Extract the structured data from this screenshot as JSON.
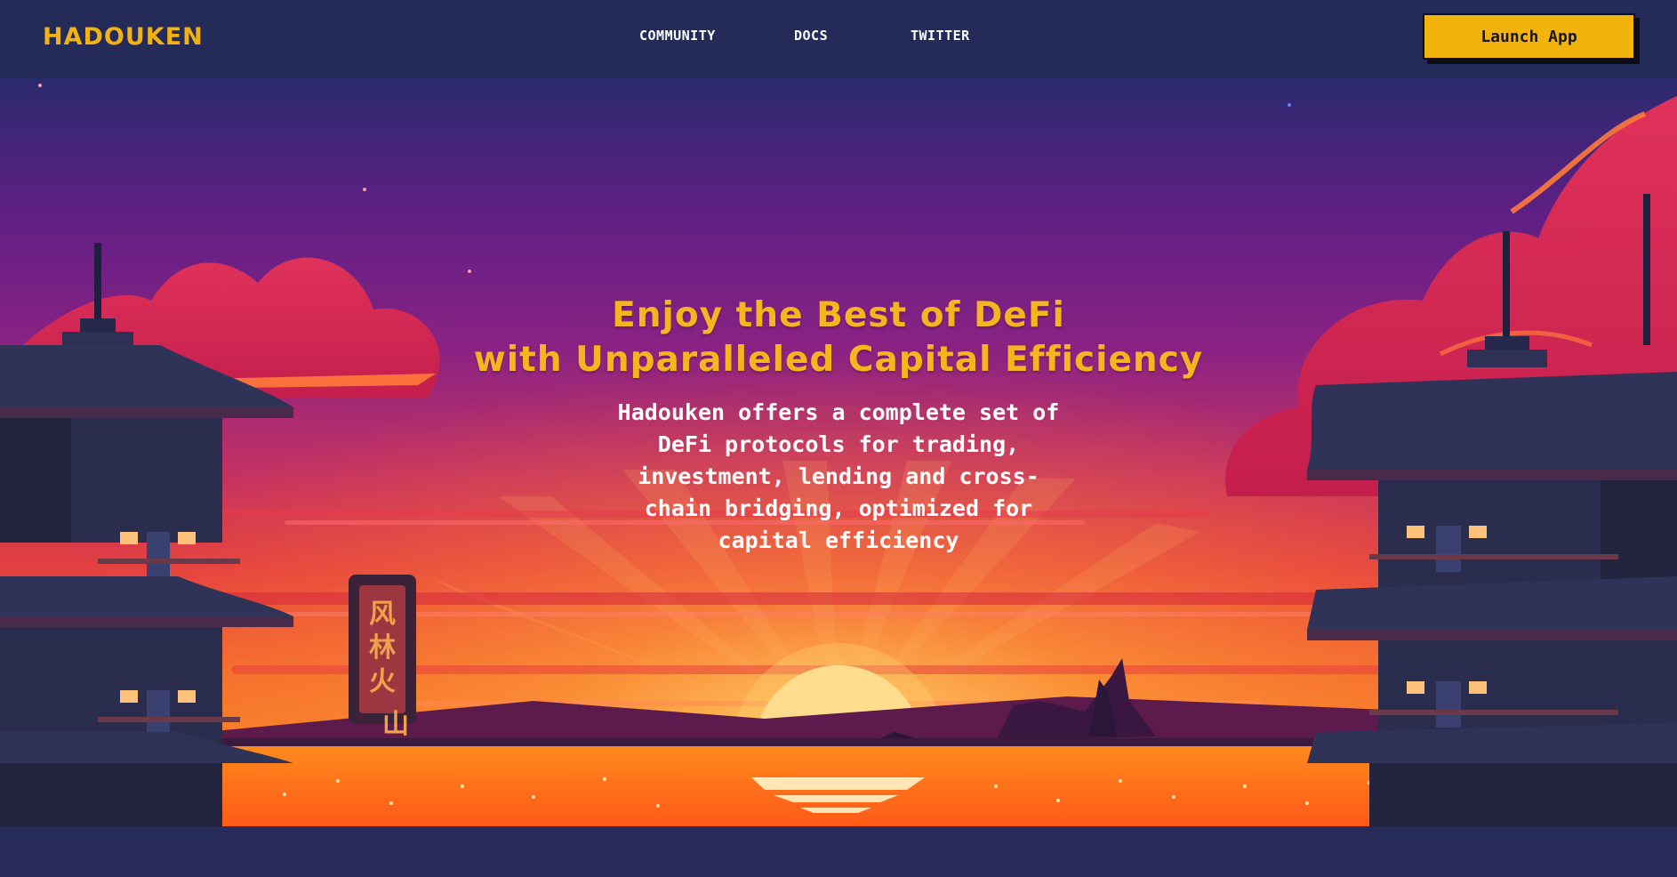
{
  "brand": {
    "name": "HADOUKEN",
    "color": "#f3b20f"
  },
  "nav": {
    "community": "COMMUNITY",
    "docs": "DOCS",
    "twitter": "TWITTER"
  },
  "launch": {
    "label": "Launch App",
    "color": "#f2b40c"
  },
  "hero": {
    "headline_line1": "Enjoy the Best of DeFi",
    "headline_line2": "with Unparalleled Capital Efficiency",
    "subcopy": "Hadouken offers a complete set of DeFi protocols for trading, investment, lending and cross-chain bridging, optimized for capital efficiency",
    "sign_text": "风林火山"
  },
  "colors": {
    "accent": "#f5b51e",
    "background": "#262b59"
  }
}
